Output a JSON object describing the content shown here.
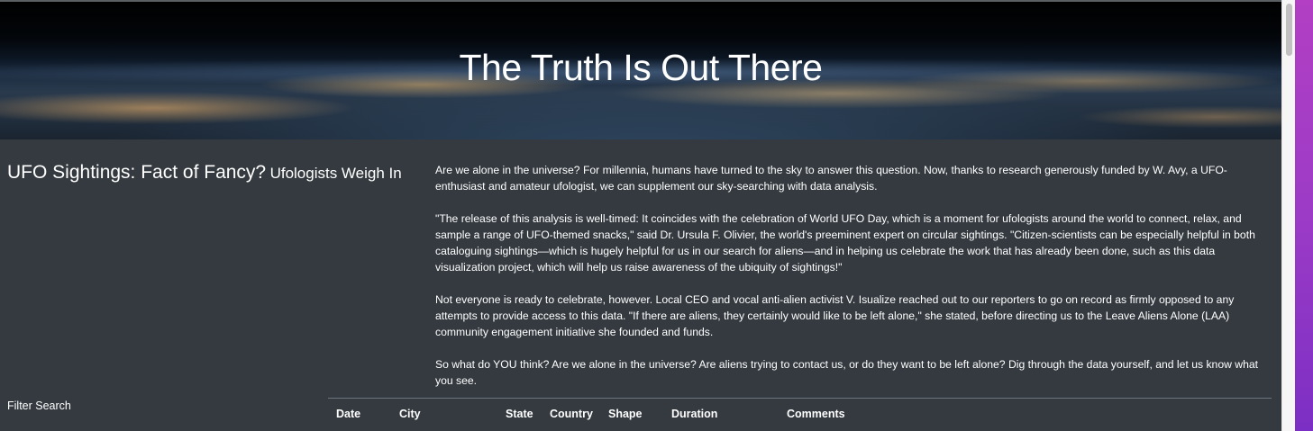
{
  "hero": {
    "title": "The Truth Is Out There"
  },
  "heading": {
    "main": "UFO Sightings: Fact of Fancy?",
    "sub": "Ufologists Weigh In"
  },
  "article": {
    "paragraphs": [
      "Are we alone in the universe? For millennia, humans have turned to the sky to answer this question. Now, thanks to research generously funded by W. Avy, a UFO-enthusiast and amateur ufologist, we can supplement our sky-searching with data analysis.",
      "\"The release of this analysis is well-timed: It coincides with the celebration of World UFO Day, which is a moment for ufologists around the world to connect, relax, and sample a range of UFO-themed snacks,\" said Dr. Ursula F. Olivier, the world's preeminent expert on circular sightings. \"Citizen-scientists can be especially helpful in both cataloguing sightings—which is hugely helpful for us in our search for aliens—and in helping us celebrate the work that has already been done, such as this data visualization project, which will help us raise awareness of the ubiquity of sightings!\"",
      "Not everyone is ready to celebrate, however. Local CEO and vocal anti-alien activist V. Isualize reached out to our reporters to go on record as firmly opposed to any attempts to provide access to this data. \"If there are aliens, they certainly would like to be left alone,\" she stated, before directing us to the Leave Aliens Alone (LAA) community engagement initiative she founded and funds.",
      "So what do YOU think? Are we alone in the universe? Are aliens trying to contact us, or do they want to be left alone? Dig through the data yourself, and let us know what you see."
    ]
  },
  "filter": {
    "label": "Filter Search"
  },
  "table": {
    "columns": [
      "Date",
      "City",
      "State",
      "Country",
      "Shape",
      "Duration",
      "Comments"
    ]
  }
}
